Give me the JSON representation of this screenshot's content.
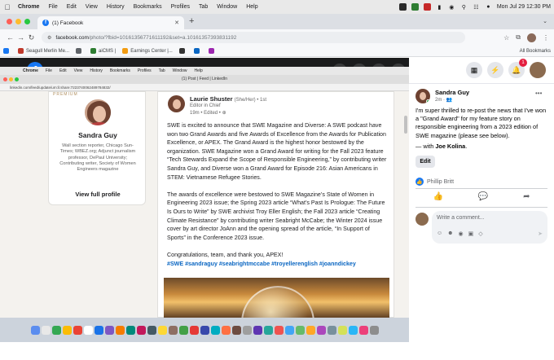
{
  "menubar": {
    "app": "Chrome",
    "items": [
      "File",
      "Edit",
      "View",
      "History",
      "Bookmarks",
      "Profiles",
      "Tab",
      "Window",
      "Help"
    ],
    "datetime": "Mon Jul 29  12:30 PM"
  },
  "tab": {
    "title": "(1) Facebook"
  },
  "omnibox": {
    "host": "facebook.com",
    "path": "/photo/?fbid=10161356771611192&set=a.10161357393831192"
  },
  "bookmarks": [
    {
      "label": "",
      "color": "#1877f2"
    },
    {
      "label": "Seagull Merlin Me...",
      "color": "#c0392b"
    },
    {
      "label": "",
      "color": "#5f6368"
    },
    {
      "label": "aiCMS |",
      "color": "#2e7d32"
    },
    {
      "label": "Earnings Center |...",
      "color": "#f39c12"
    },
    {
      "label": "",
      "color": "#333333"
    },
    {
      "label": "",
      "color": "#0a66c2"
    },
    {
      "label": "",
      "color": "#9c27b0"
    }
  ],
  "bookmarks_all": "All Bookmarks",
  "nested": {
    "menu_items": [
      "Chrome",
      "File",
      "Edit",
      "View",
      "History",
      "Bookmarks",
      "Profiles",
      "Tab",
      "Window",
      "Help"
    ],
    "window_title": "(1) Post | Feed | LinkedIn",
    "url": "linkedin.com/feed/update/urn:li:share:7223740062489784832/"
  },
  "profile": {
    "premium": "PREMIUM",
    "name": "Sandra Guy",
    "headline": "Wall section reporter, Chicago Sun-Times; WBEZ.org; Adjunct journalism professor, DePaul University; Contributing writer, Society of Women Engineers magazine",
    "view_profile": "View full profile"
  },
  "post": {
    "author": "Laurie Shuster",
    "pronouns": "(She/Her) • 1st",
    "title": "Editor in Chief",
    "meta": "19m • Edited •",
    "paragraphs": [
      "SWE is excited to announce that SWE Magazine and Diverse: A SWE podcast have won two Grand Awards and five Awards of Excellence from the Awards for Publication Excellence, or APEX. The Grand Award is the highest honor bestowed by the organization. SWE Magazine won a Grand Award for writing for the Fall 2023 feature “Tech Stewards Expand the Scope of Responsible Engineering,” by contributing writer Sandra Guy, and Diverse won a Grand Award for Episode 216: Asian Americans in STEM: Vietnamese Refugee Stories.",
      "The awards of excellence were bestowed to SWE Magazine’s State of Women in Engineering 2023 issue; the Spring 2023 article “What’s Past Is Prologue: The Future Is Ours to Write” by SWE archivist Troy Eller English; the Fall 2023 article “Creating Climate Resistance” by contributing writer Seabright McCabe; the Winter 2024 issue cover by art director JoAnn and the opening spread of the article, “In Support of Sports” in the Conference 2023 issue.",
      "Congratulations, team, and thank you, APEX!"
    ],
    "tags": "#SWE #sandraguy #seabrightmccabe #troyellerenglish #joanndickey"
  },
  "comment_panel": {
    "name": "Sandra Guy",
    "time": "2m",
    "text": "I'm super thrilled to re-post the news that I've won a \"Grand Award\" for my feature story on responsible engineering from a 2023 edition of SWE magazine (please see below).",
    "with_prefix": "— with ",
    "with_name": "Joe Kolina",
    "with_suffix": ".",
    "edit_label": "Edit",
    "liked_by": "Phillip Britt",
    "comment_placeholder": "Write a comment..."
  },
  "fb": {
    "badge": "1"
  },
  "icons": {
    "close": "close-icon",
    "logo": "facebook-logo-icon",
    "zoom_in": "zoom-in-icon",
    "zoom_out": "zoom-out-icon",
    "tag": "tag-icon",
    "fullscreen": "fullscreen-icon"
  }
}
